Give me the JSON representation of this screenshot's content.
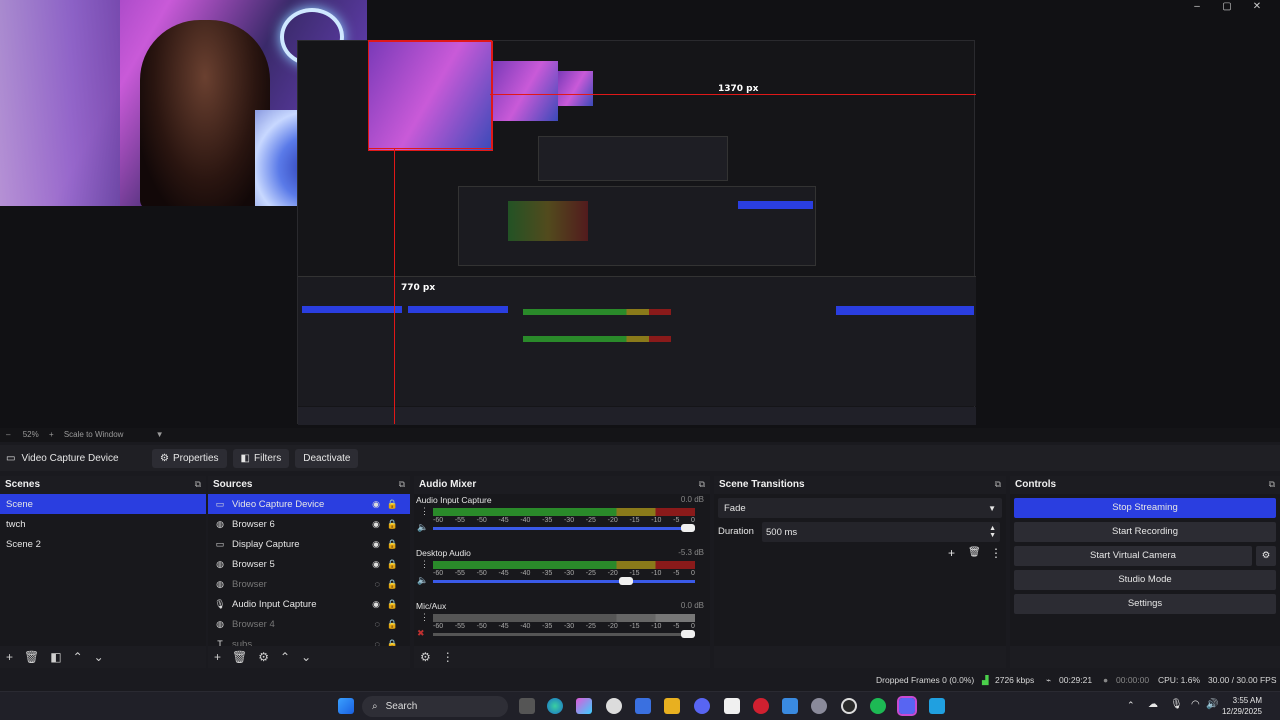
{
  "window": {
    "controls": [
      "–",
      "▢",
      "✕"
    ]
  },
  "preview": {
    "measure_h": "1370 px",
    "measure_v": "770 px"
  },
  "zoombar": {
    "zoom": "52%",
    "mode": "Scale to Window"
  },
  "source_toolbar": {
    "current_source": "Video Capture Device",
    "properties": "Properties",
    "filters": "Filters",
    "deactivate": "Deactivate"
  },
  "scenes": {
    "title": "Scenes",
    "items": [
      "Scene",
      "twch",
      "Scene 2"
    ],
    "selected": 0
  },
  "sources": {
    "title": "Sources",
    "items": [
      {
        "label": "Video Capture Device",
        "icon": "camera-icon",
        "visible": true,
        "selected": true
      },
      {
        "label": "Browser 6",
        "icon": "globe-icon",
        "visible": true
      },
      {
        "label": "Display Capture",
        "icon": "monitor-icon",
        "visible": true
      },
      {
        "label": "Browser 5",
        "icon": "globe-icon",
        "visible": true
      },
      {
        "label": "Browser",
        "icon": "globe-icon",
        "visible": false
      },
      {
        "label": "Audio Input Capture",
        "icon": "microphone-icon",
        "visible": true
      },
      {
        "label": "Browser 4",
        "icon": "globe-icon",
        "visible": false
      },
      {
        "label": "subs",
        "icon": "text-icon",
        "visible": false
      }
    ]
  },
  "audio_mixer": {
    "title": "Audio Mixer",
    "ticks": [
      "-60",
      "-55",
      "-50",
      "-45",
      "-40",
      "-35",
      "-30",
      "-25",
      "-20",
      "-15",
      "-10",
      "-5",
      "0"
    ],
    "channels": [
      {
        "name": "Audio Input Capture",
        "db": "0.0 dB",
        "level": 0.62,
        "volume": 1.0,
        "muted": false
      },
      {
        "name": "Desktop Audio",
        "db": "-5.3 dB",
        "level": 0.78,
        "volume": 0.75,
        "muted": false
      },
      {
        "name": "Mic/Aux",
        "db": "0.0 dB",
        "level": 0.55,
        "volume": 1.0,
        "muted": true
      }
    ]
  },
  "scene_transitions": {
    "title": "Scene Transitions",
    "transition": "Fade",
    "duration_label": "Duration",
    "duration_value": "500 ms"
  },
  "controls": {
    "title": "Controls",
    "stop_streaming": "Stop Streaming",
    "start_recording": "Start Recording",
    "start_virtual_camera": "Start Virtual Camera",
    "studio_mode": "Studio Mode",
    "settings": "Settings"
  },
  "status_bar": {
    "dropped_frames": "Dropped Frames 0 (0.0%)",
    "bitrate": "2726 kbps",
    "stream_time": "00:29:21",
    "record_time": "00:00:00",
    "cpu": "CPU: 1.6%",
    "fps": "30.00 / 30.00 FPS"
  },
  "taskbar": {
    "search": "Search",
    "time": "3:55 AM",
    "date": "12/29/2025"
  },
  "colors": {
    "accent": "#2a3ee0",
    "bg": "#1c1c21"
  }
}
